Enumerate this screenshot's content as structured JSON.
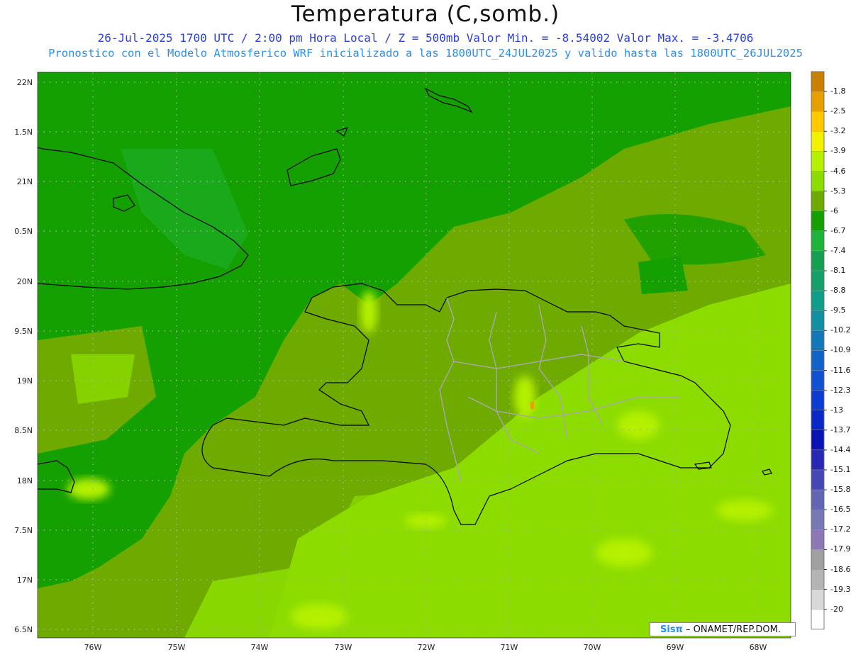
{
  "title": "Temperatura (C,somb.)",
  "subtitle_line1": "26-Jul-2025   1700 UTC / 2:00 pm Hora Local / Z = 500mb   Valor Min. = -8.54002  Valor Max. = -3.4706",
  "subtitle_line2": "Pronostico con el Modelo Atmosferico WRF inicializado a las 1800UTC_24JUL2025 y valido hasta las  1800UTC_26JUL2025",
  "lat_labels": [
    "22N",
    "1.5N",
    "21N",
    "0.5N",
    "20N",
    "9.5N",
    "19N",
    "8.5N",
    "18N",
    "7.5N",
    "17N",
    "6.5N"
  ],
  "lon_labels": [
    "76W",
    "75W",
    "74W",
    "73W",
    "72W",
    "71W",
    "70W",
    "69W",
    "68W"
  ],
  "colorbar": {
    "labels": [
      "-1.8",
      "-2.5",
      "-3.2",
      "-3.9",
      "-4.6",
      "-5.3",
      "-6",
      "-6.7",
      "-7.4",
      "-8.1",
      "-8.8",
      "-9.5",
      "-10.2",
      "-10.9",
      "-11.6",
      "-12.3",
      "-13",
      "-13.7",
      "-14.4",
      "-15.1",
      "-15.8",
      "-16.5",
      "-17.2",
      "-17.9",
      "-18.6",
      "-19.3",
      "-20"
    ],
    "colors": [
      "#c98000",
      "#e8a000",
      "#ffc800",
      "#f2f200",
      "#b4f000",
      "#8cdc00",
      "#6eaa00",
      "#14a000",
      "#1eb43c",
      "#14a050",
      "#14a068",
      "#109e88",
      "#1090a0",
      "#1278b8",
      "#1064c8",
      "#1050d2",
      "#0c3cd2",
      "#0a28c8",
      "#0a14b4",
      "#2828b4",
      "#4646b4",
      "#6464b4",
      "#7878b4",
      "#8c78b4",
      "#a0a0a0",
      "#b4b4b4",
      "#d8d8d8",
      "#ffffff"
    ]
  },
  "credit_sis": "Sisπ",
  "credit_text": " – ONAMET/REP.DOM."
}
